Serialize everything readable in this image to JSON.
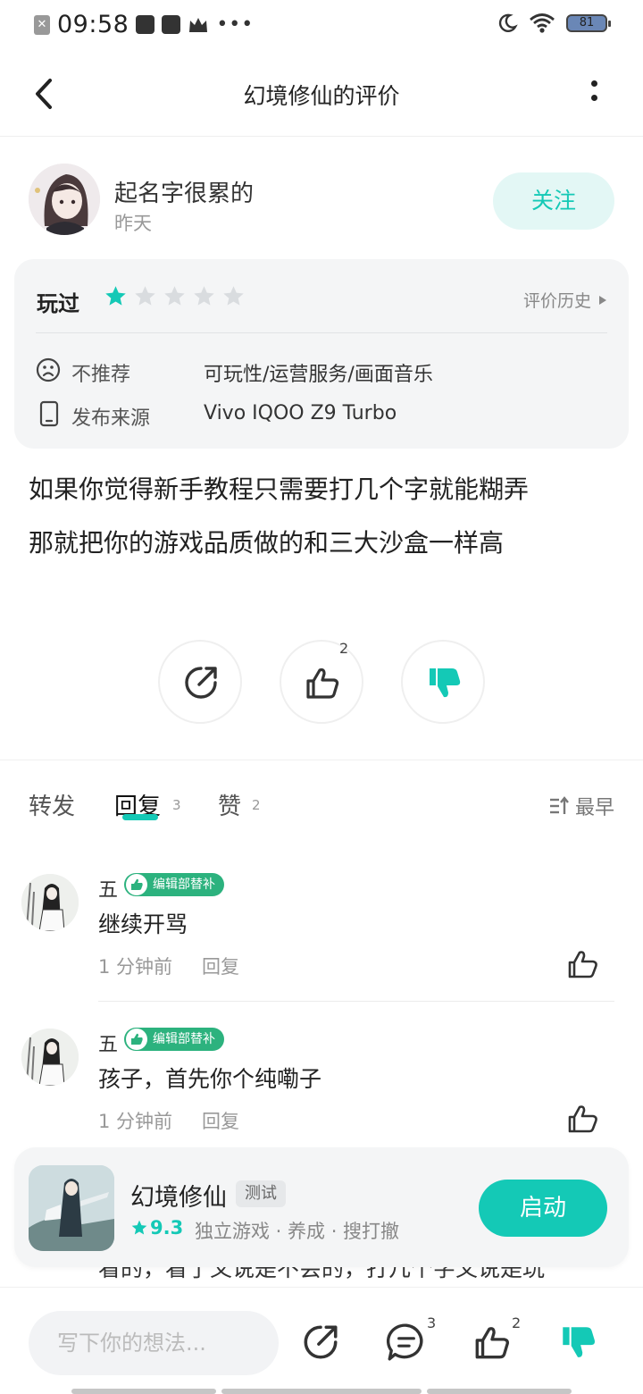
{
  "status_bar": {
    "time": "09:58",
    "battery": "81",
    "left_icons": [
      "close-notification-icon",
      "mail-icon",
      "video-icon",
      "crown-icon",
      "more-dots-icon"
    ],
    "right_icons": [
      "moon-icon",
      "wifi-icon",
      "battery-icon"
    ]
  },
  "header": {
    "title": "幻境修仙的评价",
    "back_icon": "chevron-left-icon",
    "more_icon": "more-vertical-icon"
  },
  "author": {
    "name": "起名字很累的",
    "time": "昨天",
    "follow_label": "关注"
  },
  "info": {
    "played_label": "玩过",
    "rating": 1,
    "rating_max": 5,
    "history_label": "评价历史",
    "recommend_label": "不推荐",
    "recommend_tags": "可玩性/运营服务/画面音乐",
    "source_label": "发布来源",
    "source_value": "Vivo IQOO Z9 Turbo"
  },
  "review": {
    "line1": "如果你觉得新手教程只需要打几个字就能糊弄",
    "line2": "那就把你的游戏品质做的和三大沙盒一样高"
  },
  "actions": {
    "like_count": "2",
    "icons": [
      "share-icon",
      "thumbs-up-icon",
      "thumbs-down-icon"
    ]
  },
  "tabs": {
    "repost": "转发",
    "reply": "回复",
    "reply_count": "3",
    "like": "赞",
    "like_count": "2",
    "sort_label": "最早"
  },
  "comments": [
    {
      "name": "五",
      "badge": "编辑部替补",
      "text": "继续开骂",
      "time": "1 分钟前",
      "reply_label": "回复"
    },
    {
      "name": "五",
      "badge": "编辑部替补",
      "text": "孩子，首先你个纯嘞子",
      "time": "1 分钟前",
      "reply_label": "回复"
    }
  ],
  "peek_text": "看的，看了又说是不会的，打几个字又说是玩",
  "game": {
    "name": "幻境修仙",
    "tag": "测试",
    "score": "9.3",
    "desc": "独立游戏 · 养成 · 搜打撤",
    "launch_label": "启动"
  },
  "bottom_bar": {
    "placeholder": "写下你的想法...",
    "comment_count": "3",
    "like_count": "2"
  },
  "colors": {
    "accent": "#14c9b6",
    "accent_light": "#e3f7f5",
    "badge": "#2cb27e",
    "card_bg": "#f4f5f6",
    "star_off": "#d9dcdf"
  }
}
